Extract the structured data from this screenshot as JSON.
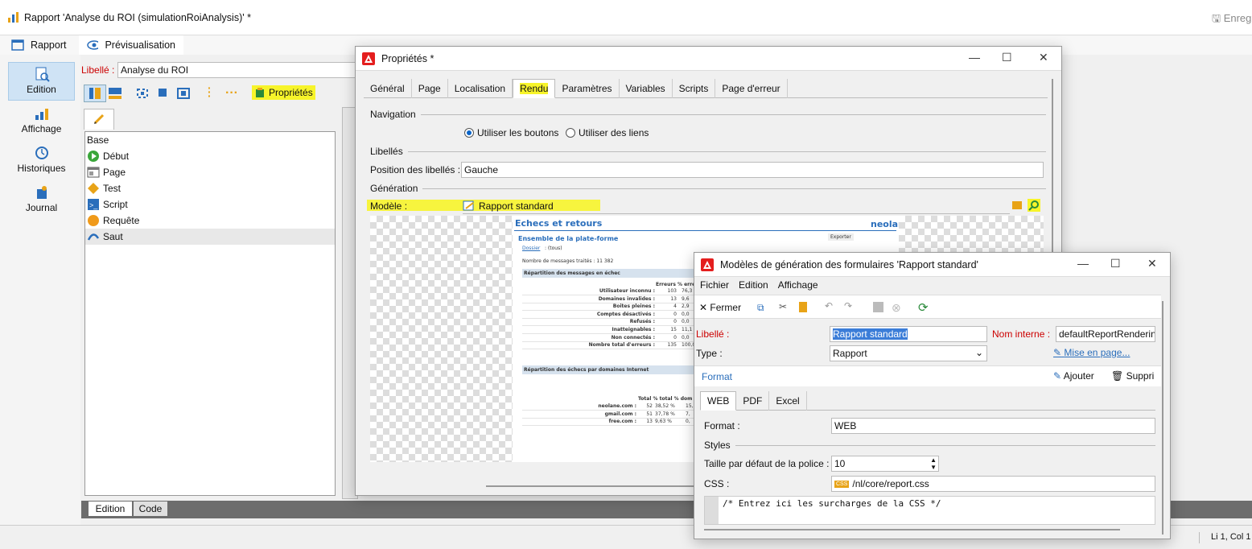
{
  "window": {
    "title": "Rapport 'Analyse du ROI (simulationRoiAnalysis)' *",
    "save_label": "Enreg"
  },
  "top_tabs": [
    "Rapport",
    "Prévisualisation"
  ],
  "nav": [
    {
      "label": "Edition"
    },
    {
      "label": "Affichage"
    },
    {
      "label": "Historiques"
    },
    {
      "label": "Journal"
    }
  ],
  "libelle": {
    "label": "Libellé :",
    "value": "Analyse du ROI"
  },
  "toolbar": {
    "props_label": "Propriétés"
  },
  "tree": {
    "root": "Base",
    "items": [
      "Début",
      "Page",
      "Test",
      "Script",
      "Requête",
      "Saut"
    ]
  },
  "bottom_tabs": [
    "Edition",
    "Code"
  ],
  "status": {
    "position": "Li 1, Col 1"
  },
  "props": {
    "title": "Propriétés *",
    "tabs": [
      "Général",
      "Page",
      "Localisation",
      "Rendu",
      "Paramètres",
      "Variables",
      "Scripts",
      "Page d'erreur"
    ],
    "navigation": {
      "title": "Navigation",
      "opt1": "Utiliser les boutons",
      "opt2": "Utiliser des liens"
    },
    "libelles": {
      "title": "Libellés",
      "pos_label": "Position des libellés :",
      "pos_value": "Gauche"
    },
    "generation": {
      "title": "Génération",
      "model_label": "Modèle :",
      "model_value": "Rapport standard"
    },
    "preview": {
      "heading": "Echecs et retours",
      "logo": "neolane",
      "sub": "Ensemble de la plate-forme",
      "export": "Exporter",
      "dossier": "Dossier",
      "dossier_val": ": (tous)",
      "msg_count": "Nombre de messages traités :  11 382",
      "sec1": "Répartition des messages en échec",
      "sec1_cols": "Erreurs  % erre",
      "rows": [
        [
          "Utilisateur inconnu :",
          "103",
          "76,3"
        ],
        [
          "Domaines invalides :",
          "13",
          "9,6"
        ],
        [
          "Boites pleines :",
          "4",
          "2,9"
        ],
        [
          "Comptes désactivés :",
          "0",
          "0,0"
        ],
        [
          "Refusés :",
          "0",
          "0,0"
        ],
        [
          "Inatteignables :",
          "15",
          "11,1"
        ],
        [
          "Non connectés :",
          "0",
          "0,0"
        ],
        [
          "Nombre total d'erreurs :",
          "135",
          "100,0"
        ]
      ],
      "sec2": "Répartition des échecs par domaines Internet",
      "sec2_cols": "Total  % total  % dom",
      "rows2": [
        [
          "neolane.com :",
          "52",
          "38,52 %",
          "15,"
        ],
        [
          "gmail.com :",
          "51",
          "37,78 %",
          "7,"
        ],
        [
          "free.com :",
          "13",
          "9,63 %",
          "0,"
        ]
      ]
    }
  },
  "models": {
    "title": "Modèles de génération des formulaires 'Rapport standard'",
    "menu": [
      "Fichier",
      "Edition",
      "Affichage"
    ],
    "close_label": "Fermer",
    "libelle_label": "Libellé :",
    "libelle_value": "Rapport standard",
    "internal_label": "Nom interne :",
    "internal_value": "defaultReportRendering",
    "type_label": "Type :",
    "type_value": "Rapport",
    "layout_link": "Mise en page...",
    "format_section": "Format",
    "add_label": "Ajouter",
    "delete_label": "Suppri",
    "tabs": [
      "WEB",
      "PDF",
      "Excel"
    ],
    "format_label": "Format :",
    "format_value": "WEB",
    "styles_label": "Styles",
    "font_label": "Taille par défaut de la police :",
    "font_value": "10",
    "css_label": "CSS :",
    "css_value": "/nl/core/report.css",
    "css_comment": "/* Entrez ici les surcharges de la CSS */"
  }
}
